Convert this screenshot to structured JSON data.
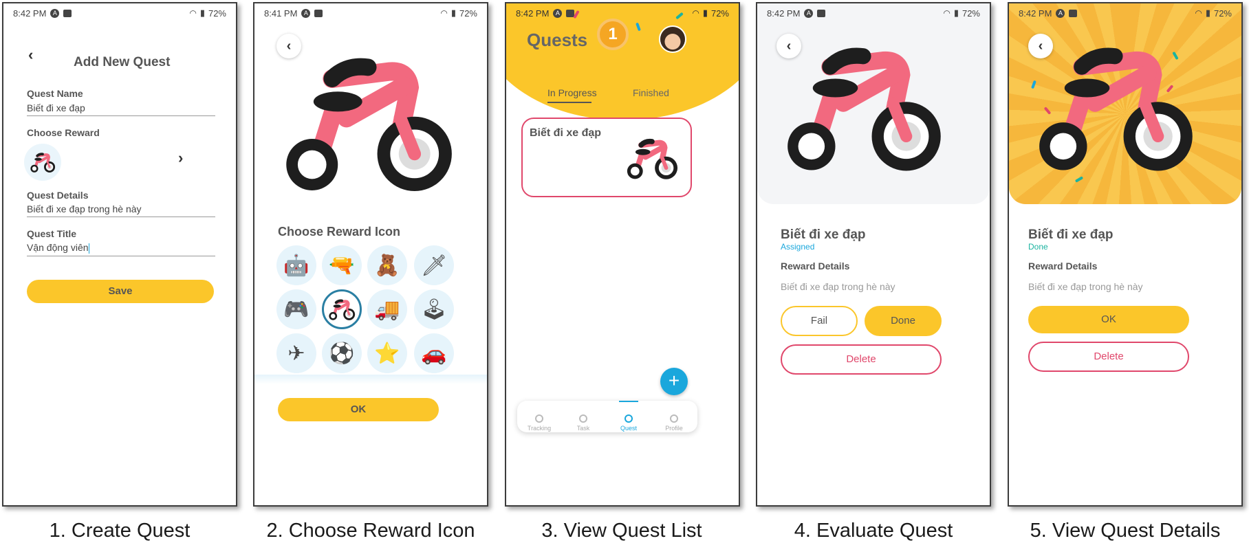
{
  "colors": {
    "accent": "#fbc62a",
    "pink": "#e0476b",
    "blue": "#1aa7dc",
    "green": "#1bb3a0"
  },
  "captions": [
    "1. Create Quest",
    "2. Choose Reward Icon",
    "3. View Quest List",
    "4. Evaluate Quest",
    "5. View Quest Details"
  ],
  "screen1": {
    "status": {
      "time": "8:42 PM",
      "battery": "72%"
    },
    "title": "Add New Quest",
    "quest_name_label": "Quest Name",
    "quest_name_value": "Biết đi xe đạp",
    "choose_reward_label": "Choose Reward",
    "reward_icon": "bicycle-icon",
    "quest_details_label": "Quest Details",
    "quest_details_value": "Biết đi xe đạp trong hè này",
    "quest_title_label": "Quest Title",
    "quest_title_value": "Vận động viên",
    "save_label": "Save"
  },
  "screen2": {
    "status": {
      "time": "8:41 PM",
      "battery": "72%"
    },
    "heading": "Choose Reward Icon",
    "icons": [
      "robot-icon",
      "water-gun-icon",
      "teddy-bear-icon",
      "sword-icon",
      "game-console-icon",
      "bicycle-icon",
      "truck-icon",
      "remote-control-icon",
      "plane-icon",
      "ball-icon",
      "star-badge-icon",
      "car-icon"
    ],
    "selected_icon": "bicycle-icon",
    "ok_label": "OK"
  },
  "screen3": {
    "status": {
      "time": "8:42 PM",
      "battery": "72%"
    },
    "title": "Quests",
    "medal_number": "1",
    "tabs": [
      "In Progress",
      "Finished"
    ],
    "active_tab": "In Progress",
    "quest_card_title": "Biết đi xe đạp",
    "fab_label": "+",
    "nav": [
      "Tracking",
      "Task",
      "Quest",
      "Profile"
    ],
    "active_nav": "Quest"
  },
  "screen4": {
    "status": {
      "time": "8:42 PM",
      "battery": "72%"
    },
    "quest_title": "Biết đi xe đạp",
    "state": "Assigned",
    "reward_details_label": "Reward Details",
    "reward_details_value": "Biết đi xe đạp trong hè này",
    "fail_label": "Fail",
    "done_label": "Done",
    "delete_label": "Delete"
  },
  "screen5": {
    "status": {
      "time": "8:42 PM",
      "battery": "72%"
    },
    "quest_title": "Biết đi xe đạp",
    "state": "Done",
    "reward_details_label": "Reward Details",
    "reward_details_value": "Biết đi xe đạp trong hè này",
    "ok_label": "OK",
    "delete_label": "Delete"
  }
}
